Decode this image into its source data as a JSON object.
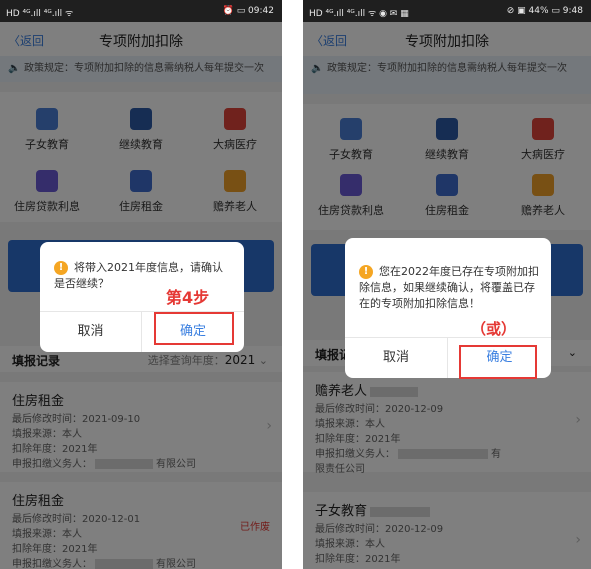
{
  "left": {
    "status_left": "HD ⁴ᴳ.ıll ⁴ᴳ.ıll ᯤ",
    "status_right": "⏰ ▭ 09:42",
    "back": "〈返回",
    "title": "专项附加扣除",
    "notice": "政策规定：专项附加扣除的信息需纳税人每年提交一次",
    "grid": [
      "子女教育",
      "继续教育",
      "大病医疗",
      "住房贷款利息",
      "住房租金",
      "赡养老人"
    ],
    "record_title": "填报记录",
    "year_hint": "选择查询年度：",
    "year_value": "2021",
    "card1": {
      "title": "住房租金",
      "modified": "最后修改时间：2021-09-10",
      "source": "填报来源：本人",
      "year": "扣除年度：2021年",
      "agent_prefix": "申报扣缴义务人：",
      "agent_suffix": "有限公司"
    },
    "card2": {
      "title": "住房租金",
      "modified": "最后修改时间：2020-12-01",
      "source": "填报来源：本人",
      "year": "扣除年度：2021年",
      "agent_prefix": "申报扣缴义务人：",
      "agent_suffix": "有限公司",
      "status": "已作废"
    },
    "dialog_msg": "将带入2021年度信息，请确认是否继续？",
    "cancel": "取消",
    "ok": "确定",
    "annotation": "第4步"
  },
  "right": {
    "status_left": "HD ⁴ᴳ.ıll ⁴ᴳ.ıll ᯤ ◉ ✉ ▦",
    "status_right": "⊘ ▣ 44% ▭ 9:48",
    "back": "〈返回",
    "title": "专项附加扣除",
    "notice": "政策规定：专项附加扣除的信息需纳税人每年提交一次",
    "grid": [
      "子女教育",
      "继续教育",
      "大病医疗",
      "住房贷款利息",
      "住房租金",
      "赡养老人"
    ],
    "record_title": "填报记录",
    "card1": {
      "title": "赡养老人",
      "modified": "最后修改时间：2020-12-09",
      "source": "填报来源：本人",
      "year": "扣除年度：2021年",
      "agent_prefix": "申报扣缴义务人：",
      "agent_suffix": "有",
      "agent_line2": "限责任公司"
    },
    "card2": {
      "title": "子女教育",
      "modified": "最后修改时间：2020-12-09",
      "source": "填报来源：本人",
      "year": "扣除年度：2021年"
    },
    "dialog_msg": "您在2022年度已存在专项附加扣除信息，如果继续确认，将覆盖已存在的专项附加扣除信息！",
    "cancel": "取消",
    "ok": "确定",
    "annotation": "（或）"
  },
  "colors": {
    "accent": "#3a7fe0",
    "annotation": "#e53935",
    "icons": [
      "#4a7fd6",
      "#2d5aa6",
      "#e0453b",
      "#6a5bd6",
      "#3f6ccf",
      "#f0a028"
    ]
  },
  "icons": {
    "grid": [
      "kids-education-icon",
      "continuing-education-icon",
      "medical-icon",
      "housing-loan-icon",
      "rent-icon",
      "elderly-care-icon"
    ],
    "speaker": "speaker-icon",
    "warning": "warning-icon"
  }
}
